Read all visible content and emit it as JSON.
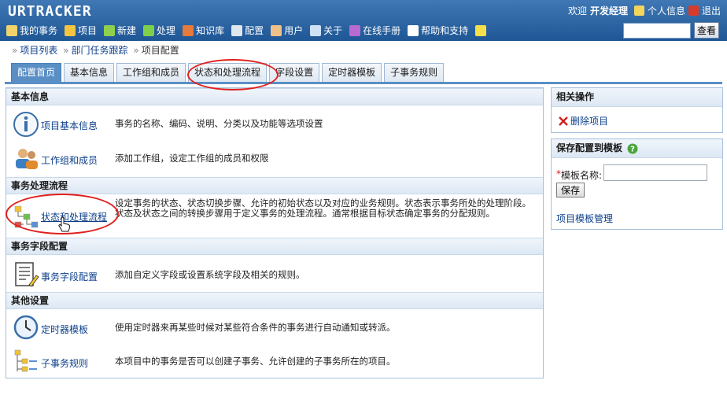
{
  "app": {
    "logo": "URTRACKER"
  },
  "header": {
    "welcome_text": "欢迎",
    "user_name": "开发经理",
    "personal_info": "个人信息",
    "logout": "退出"
  },
  "nav": [
    {
      "label": "我的事务",
      "icon": "home-icon",
      "color": "#f2d36b"
    },
    {
      "label": "项目",
      "icon": "database-icon",
      "color": "#f3c440"
    },
    {
      "label": "新建",
      "icon": "new-icon",
      "color": "#8fcf4f"
    },
    {
      "label": "处理",
      "icon": "check-icon",
      "color": "#7ed04a"
    },
    {
      "label": "知识库",
      "icon": "books-icon",
      "color": "#e57a3a"
    },
    {
      "label": "配置",
      "icon": "gear-icon",
      "color": "#dfe6ee"
    },
    {
      "label": "用户",
      "icon": "users-icon",
      "color": "#f0c08a"
    },
    {
      "label": "关于",
      "icon": "info-icon",
      "color": "#cfe1f7"
    },
    {
      "label": "在线手册",
      "icon": "book-icon",
      "color": "#b86ad1"
    },
    {
      "label": "帮助和支持",
      "icon": "help-icon",
      "color": "#ffffff"
    },
    {
      "label": "",
      "icon": "star-icon",
      "color": "#f6e04a"
    }
  ],
  "search": {
    "placeholder": "",
    "button": "查看"
  },
  "breadcrumb": [
    "项目列表",
    "部门任务跟踪",
    "项目配置"
  ],
  "tabs": [
    {
      "label": "配置首页",
      "active": true
    },
    {
      "label": "基本信息",
      "active": false
    },
    {
      "label": "工作组和成员",
      "active": false
    },
    {
      "label": "状态和处理流程",
      "active": false
    },
    {
      "label": "字段设置",
      "active": false
    },
    {
      "label": "定时器模板",
      "active": false
    },
    {
      "label": "子事务规则",
      "active": false
    }
  ],
  "sections": {
    "basic": {
      "title": "基本信息",
      "items": [
        {
          "link": "项目基本信息",
          "desc": "事务的名称、编码、说明、分类以及功能等选项设置"
        },
        {
          "link": "工作组和成员",
          "desc": "添加工作组，设定工作组的成员和权限"
        }
      ]
    },
    "workflow": {
      "title": "事务处理流程",
      "items": [
        {
          "link": "状态和处理流程",
          "desc": "设定事务的状态、状态切换步骤、允许的初始状态以及对应的业务规则。状态表示事务所处的处理阶段。状态及状态之间的转换步骤用于定义事务的处理流程。通常根据目标状态确定事务的分配规则。"
        }
      ]
    },
    "fields": {
      "title": "事务字段配置",
      "items": [
        {
          "link": "事务字段配置",
          "desc": "添加自定义字段或设置系统字段及相关的规则。"
        }
      ]
    },
    "other": {
      "title": "其他设置",
      "items": [
        {
          "link": "定时器模板",
          "desc": "使用定时器来再某些时候对某些符合条件的事务进行自动通知或转派。"
        },
        {
          "link": "子事务规则",
          "desc": "本项目中的事务是否可以创建子事务、允许创建的子事务所在的项目。"
        }
      ]
    }
  },
  "right": {
    "ops_title": "相关操作",
    "delete_project": "删除项目",
    "save_title": "保存配置到模板",
    "required_mark": "*",
    "template_name_label": "模板名称:",
    "template_name_value": "",
    "save_button": "保存",
    "template_manage": "项目模板管理"
  },
  "colors": {
    "header": "#2d66a4",
    "accent": "#5a8fc5",
    "annotation": "#e0201e"
  }
}
